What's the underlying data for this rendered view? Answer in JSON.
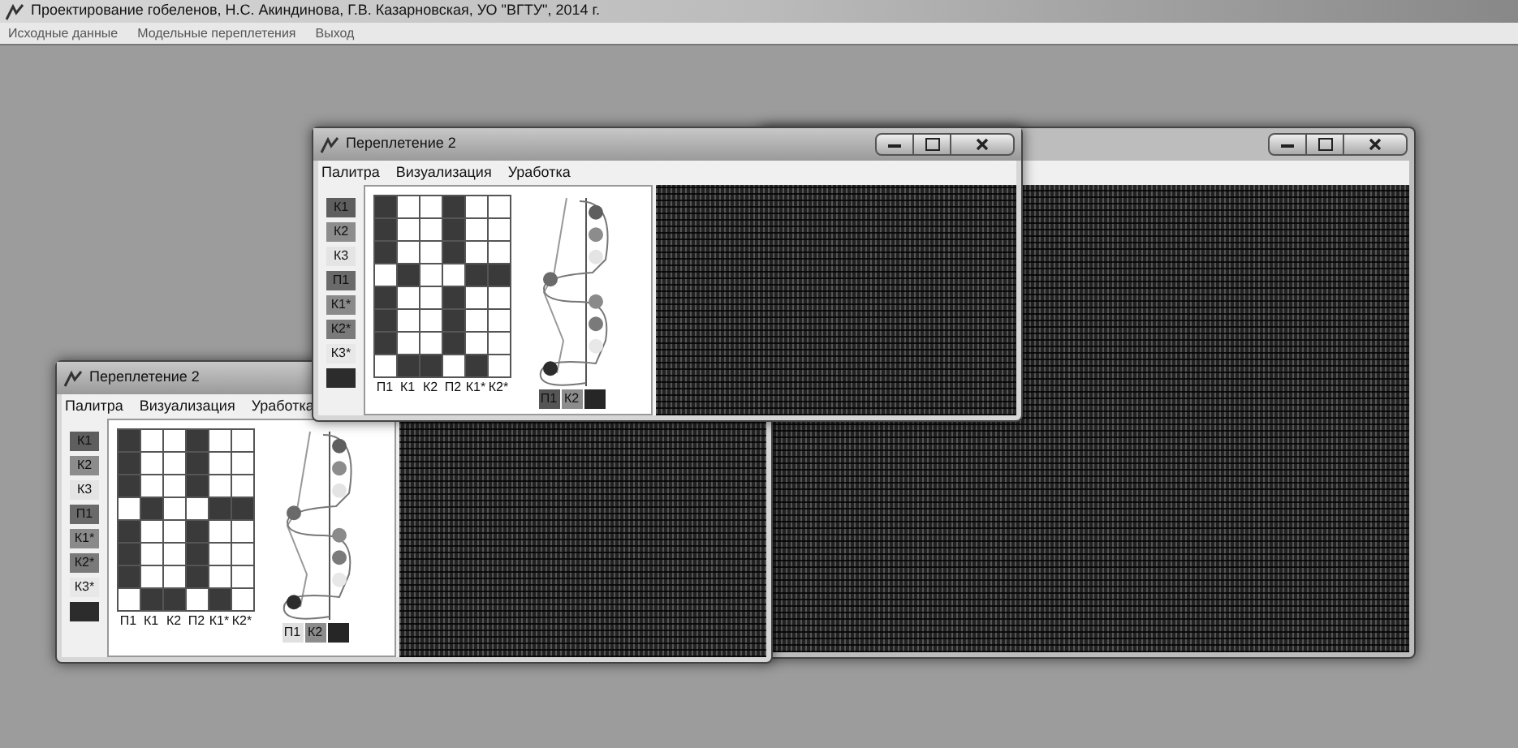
{
  "app": {
    "title": "Проектирование гобеленов, Н.С. Акиндинова, Г.В. Казарновская, УО \"ВГТУ\", 2014 г.",
    "menu": [
      "Исходные данные",
      "Модельные переплетения",
      "Выход"
    ]
  },
  "windows": [
    {
      "title": "Переплетение 2",
      "menu": [
        "Палитра",
        "Визуализация",
        "Уработка"
      ],
      "palette": [
        {
          "label": "К1",
          "kind": "weft",
          "color": "#5e5e5e"
        },
        {
          "label": "К2",
          "kind": "weft",
          "color": "#8c8c8c"
        },
        {
          "label": "К3",
          "kind": "weft",
          "color": "#e4e4e4"
        },
        {
          "label": "П1",
          "kind": "warp",
          "color": "#6a6a6a"
        },
        {
          "label": "К1*",
          "kind": "weft",
          "color": "#8a8a8a"
        },
        {
          "label": "К2*",
          "kind": "weft",
          "color": "#7a7a7a"
        },
        {
          "label": "К3*",
          "kind": "weft",
          "color": "#e8e8e8"
        },
        {
          "kind": "warp",
          "color": "#2c2c2c"
        }
      ],
      "grid": [
        [
          true,
          false,
          false,
          true,
          false,
          false
        ],
        [
          true,
          false,
          false,
          true,
          false,
          false
        ],
        [
          true,
          false,
          false,
          true,
          false,
          false
        ],
        [
          false,
          true,
          false,
          false,
          true,
          true
        ],
        [
          true,
          false,
          false,
          true,
          false,
          false
        ],
        [
          true,
          false,
          false,
          true,
          false,
          false
        ],
        [
          true,
          false,
          false,
          true,
          false,
          false
        ],
        [
          false,
          true,
          true,
          false,
          true,
          false
        ]
      ],
      "column_labels": [
        "П1",
        "К1",
        "К2",
        "П2",
        "К1*",
        "К2*"
      ],
      "swatches": [
        {
          "label": "П1",
          "color": "#555555"
        },
        {
          "label": "К2",
          "color": "#8c8c8c"
        },
        {
          "color": "#262626"
        }
      ]
    },
    {
      "title": "Переплетение 2",
      "menu": [
        "Палитра",
        "Визуализация",
        "Уработка"
      ],
      "palette": [
        {
          "label": "К1",
          "kind": "weft",
          "color": "#5e5e5e"
        },
        {
          "label": "К2",
          "kind": "weft",
          "color": "#8c8c8c"
        },
        {
          "label": "К3",
          "kind": "weft",
          "color": "#e4e4e4"
        },
        {
          "label": "П1",
          "kind": "warp",
          "color": "#6a6a6a"
        },
        {
          "label": "К1*",
          "kind": "weft",
          "color": "#8a8a8a"
        },
        {
          "label": "К2*",
          "kind": "weft",
          "color": "#7a7a7a"
        },
        {
          "label": "К3*",
          "kind": "weft",
          "color": "#e8e8e8"
        },
        {
          "kind": "warp",
          "color": "#2c2c2c"
        }
      ],
      "grid": [
        [
          true,
          false,
          false,
          true,
          false,
          false
        ],
        [
          true,
          false,
          false,
          true,
          false,
          false
        ],
        [
          true,
          false,
          false,
          true,
          false,
          false
        ],
        [
          false,
          true,
          false,
          false,
          true,
          true
        ],
        [
          true,
          false,
          false,
          true,
          false,
          false
        ],
        [
          true,
          false,
          false,
          true,
          false,
          false
        ],
        [
          true,
          false,
          false,
          true,
          false,
          false
        ],
        [
          false,
          true,
          true,
          false,
          true,
          false
        ]
      ],
      "column_labels": [
        "П1",
        "К1",
        "К2",
        "П2",
        "К1*",
        "К2*"
      ],
      "swatches": [
        {
          "label": "П1",
          "color": "#e0e0e0"
        },
        {
          "label": "К2",
          "color": "#8c8c8c"
        },
        {
          "color": "#262626"
        }
      ]
    }
  ]
}
